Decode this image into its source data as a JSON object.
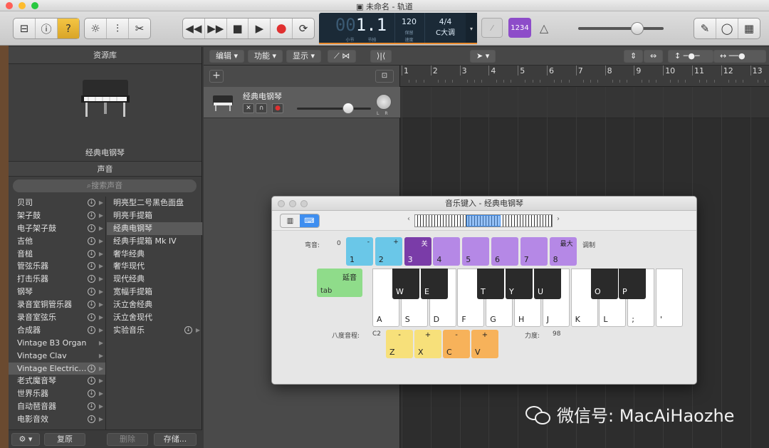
{
  "window": {
    "title": "未命名 - 轨道"
  },
  "toolbar": {
    "lcd_bar": "1",
    "lcd_beat": "1",
    "lcd_bar_label": "小节",
    "lcd_beat_label": "节拍",
    "tempo": "120",
    "tempo_sub": "保留",
    "tempo_label": "速度",
    "signature": "4/4",
    "key": "C大调",
    "count_in": "1234",
    "accent_color": "#8d4cc9"
  },
  "library": {
    "header": "资源库",
    "instrument_name": "经典电钢琴",
    "sound_header": "声音",
    "search_placeholder": "搜索声音",
    "categories": [
      {
        "label": "贝司",
        "dl": true,
        "sel": false
      },
      {
        "label": "架子鼓",
        "dl": true,
        "sel": false
      },
      {
        "label": "电子架子鼓",
        "dl": true,
        "sel": false
      },
      {
        "label": "吉他",
        "dl": true,
        "sel": false
      },
      {
        "label": "音槌",
        "dl": true,
        "sel": false
      },
      {
        "label": "管弦乐器",
        "dl": true,
        "sel": false
      },
      {
        "label": "打击乐器",
        "dl": true,
        "sel": false
      },
      {
        "label": "钢琴",
        "dl": true,
        "sel": false
      },
      {
        "label": "录音室铜管乐器",
        "dl": true,
        "sel": false
      },
      {
        "label": "录音室弦乐",
        "dl": true,
        "sel": false
      },
      {
        "label": "合成器",
        "dl": true,
        "sel": false
      },
      {
        "label": "Vintage B3 Organ",
        "dl": false,
        "sel": false
      },
      {
        "label": "Vintage Clav",
        "dl": false,
        "sel": false
      },
      {
        "label": "Vintage Electric…",
        "dl": true,
        "sel": true
      },
      {
        "label": "老式魔音琴",
        "dl": true,
        "sel": false
      },
      {
        "label": "世界乐器",
        "dl": true,
        "sel": false
      },
      {
        "label": "自动琶音器",
        "dl": true,
        "sel": false
      },
      {
        "label": "电影音效",
        "dl": true,
        "sel": false
      }
    ],
    "sounds": [
      {
        "label": "明亮型二号黑色面盘",
        "sel": false,
        "dl": false
      },
      {
        "label": "明亮手提箱",
        "sel": false,
        "dl": false
      },
      {
        "label": "经典电钢琴",
        "sel": true,
        "dl": false
      },
      {
        "label": "经典手提箱 Mk IV",
        "sel": false,
        "dl": false
      },
      {
        "label": "奢华经典",
        "sel": false,
        "dl": false
      },
      {
        "label": "奢华现代",
        "sel": false,
        "dl": false
      },
      {
        "label": "现代经典",
        "sel": false,
        "dl": false
      },
      {
        "label": "宽幅手提箱",
        "sel": false,
        "dl": false
      },
      {
        "label": "沃立舍经典",
        "sel": false,
        "dl": false
      },
      {
        "label": "沃立舍现代",
        "sel": false,
        "dl": false
      },
      {
        "label": "实验音乐",
        "sel": false,
        "dl": true
      }
    ],
    "footer": {
      "revert": "复原",
      "delete": "删除",
      "save": "存储..."
    }
  },
  "tracks": {
    "menus": {
      "edit": "编辑",
      "functions": "功能",
      "view": "显示"
    },
    "track_name": "经典电钢琴",
    "pan_l": "L",
    "pan_r": "R",
    "ruler": [
      "1",
      "2",
      "3",
      "4",
      "5",
      "6",
      "7",
      "8",
      "9",
      "10",
      "11",
      "12",
      "13"
    ]
  },
  "musical_typing": {
    "title": "音乐键入 - 经典电钢琴",
    "pitch_label": "弯音:",
    "pitch_value": "0",
    "mod_label": "调制",
    "top_keys": [
      {
        "t": "-",
        "b": "1",
        "color": "blue"
      },
      {
        "t": "+",
        "b": "2",
        "color": "blue"
      },
      {
        "t": "关",
        "b": "3",
        "color": "dark"
      },
      {
        "t": "",
        "b": "4",
        "color": "purple"
      },
      {
        "t": "",
        "b": "5",
        "color": "purple"
      },
      {
        "t": "",
        "b": "6",
        "color": "purple"
      },
      {
        "t": "",
        "b": "7",
        "color": "purple"
      },
      {
        "t": "最大",
        "b": "8",
        "color": "purple"
      }
    ],
    "sustain_top": "延音",
    "sustain_bottom": "tab",
    "white_keys": [
      "A",
      "S",
      "D",
      "F",
      "G",
      "H",
      "J",
      "K",
      "L",
      ";",
      "'"
    ],
    "black_keys": [
      "W",
      "E",
      "T",
      "Y",
      "U",
      "O",
      "P"
    ],
    "octave_label": "八度音程:",
    "octave_value": "C2",
    "octave_keys": [
      {
        "t": "-",
        "b": "Z",
        "color": "yellow"
      },
      {
        "t": "+",
        "b": "X",
        "color": "yellow"
      },
      {
        "t": "-",
        "b": "C",
        "color": "orange"
      },
      {
        "t": "+",
        "b": "V",
        "color": "orange"
      }
    ],
    "velocity_label": "力度:",
    "velocity_value": "98"
  },
  "watermark": "微信号: MacAiHaozhe"
}
